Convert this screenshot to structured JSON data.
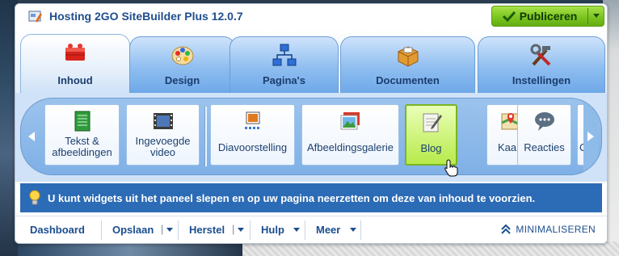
{
  "app": {
    "title": "Hosting 2GO SiteBuilder Plus 12.0.7",
    "publish_label": "Publiceren",
    "accent": "#7cc520"
  },
  "tabs": [
    {
      "label": "Inhoud",
      "icon": "bricks-icon",
      "active": true
    },
    {
      "label": "Design",
      "icon": "palette-icon",
      "active": false
    },
    {
      "label": "Pagina's",
      "icon": "sitemap-icon",
      "active": false
    },
    {
      "label": "Documenten",
      "icon": "box-icon",
      "active": false
    },
    {
      "label": "Instellingen",
      "icon": "tools-icon",
      "active": false
    }
  ],
  "widgets": [
    {
      "label": "Tekst & afbeeldingen",
      "icon": "text-document-icon"
    },
    {
      "label": "Ingevoegde video",
      "icon": "film-icon"
    },
    {
      "label": "Diavoorstelling",
      "icon": "slideshow-icon"
    },
    {
      "label": "Afbeeldingsgalerie",
      "icon": "gallery-icon"
    },
    {
      "label": "Blog",
      "icon": "notepad-pencil-icon",
      "selected": true
    },
    {
      "label": "Kaart",
      "icon": "map-icon"
    },
    {
      "label": "Reacties",
      "icon": "speech-bubble-icon"
    },
    {
      "label": "C",
      "icon": "partial-widget"
    }
  ],
  "info": {
    "text": "U kunt widgets uit het paneel slepen en op uw pagina neerzetten om deze van inhoud te voorzien."
  },
  "toolbar": {
    "dashboard": "Dashboard",
    "opslaan": "Opslaan",
    "herstel": "Herstel",
    "hulp": "Hulp",
    "meer": "Meer",
    "minimize": "MINIMALISEREN"
  }
}
